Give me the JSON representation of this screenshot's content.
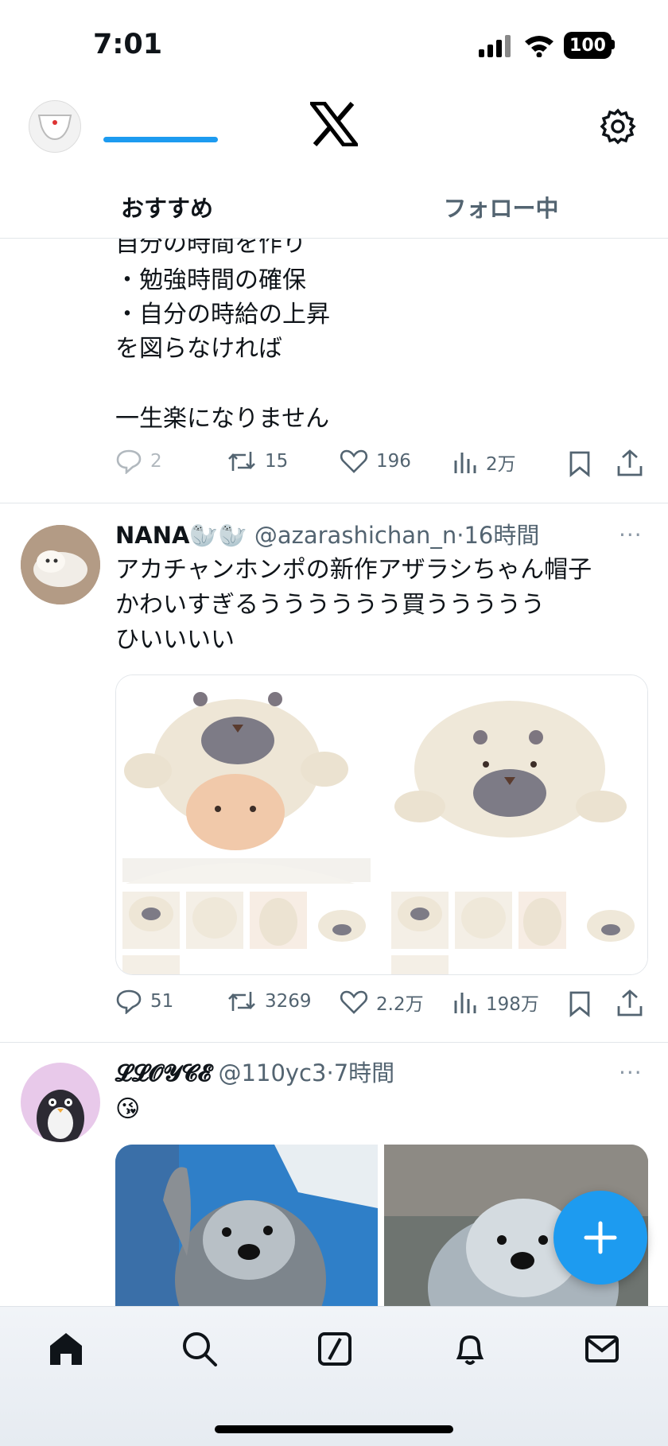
{
  "status_bar": {
    "time": "7:01",
    "battery": "100"
  },
  "header": {
    "logo": "x-logo-icon"
  },
  "tabs": [
    {
      "label": "おすすめ",
      "active": true
    },
    {
      "label": "フォロー中",
      "active": false
    }
  ],
  "posts": [
    {
      "text_lines": [
        "自分の時間を作り",
        "・勉強時間の確保",
        "・自分の時給の上昇",
        "を図らなければ",
        "",
        "一生楽になりません"
      ],
      "stats": {
        "replies": "2",
        "reposts": "15",
        "likes": "196",
        "views": "2万"
      }
    },
    {
      "display_name": "NANA🦭🦭",
      "handle": "@azarashichan_n",
      "time": "16時間",
      "text_lines": [
        "アカチャンホンポの新作アザラシちゃん帽子",
        "かわいすぎるうううううう買ううううう",
        "ひいいいい"
      ],
      "stats": {
        "replies": "51",
        "reposts": "3269",
        "likes": "2.2万",
        "views": "198万"
      }
    },
    {
      "display_name": "𝓛𝓛𝓞𝓨𝓒𝓔",
      "handle": "@110yc3",
      "time": "7時間",
      "text_lines": [
        "😘"
      ]
    }
  ],
  "separator": "·",
  "more_glyph": "···",
  "fab": {
    "label": "+"
  },
  "bottom_nav": [
    "home-icon",
    "search-icon",
    "grok-icon",
    "notifications-icon",
    "messages-icon"
  ],
  "colors": {
    "accent": "#1d9bf0",
    "text": "#0f1419",
    "muted": "#536471"
  }
}
